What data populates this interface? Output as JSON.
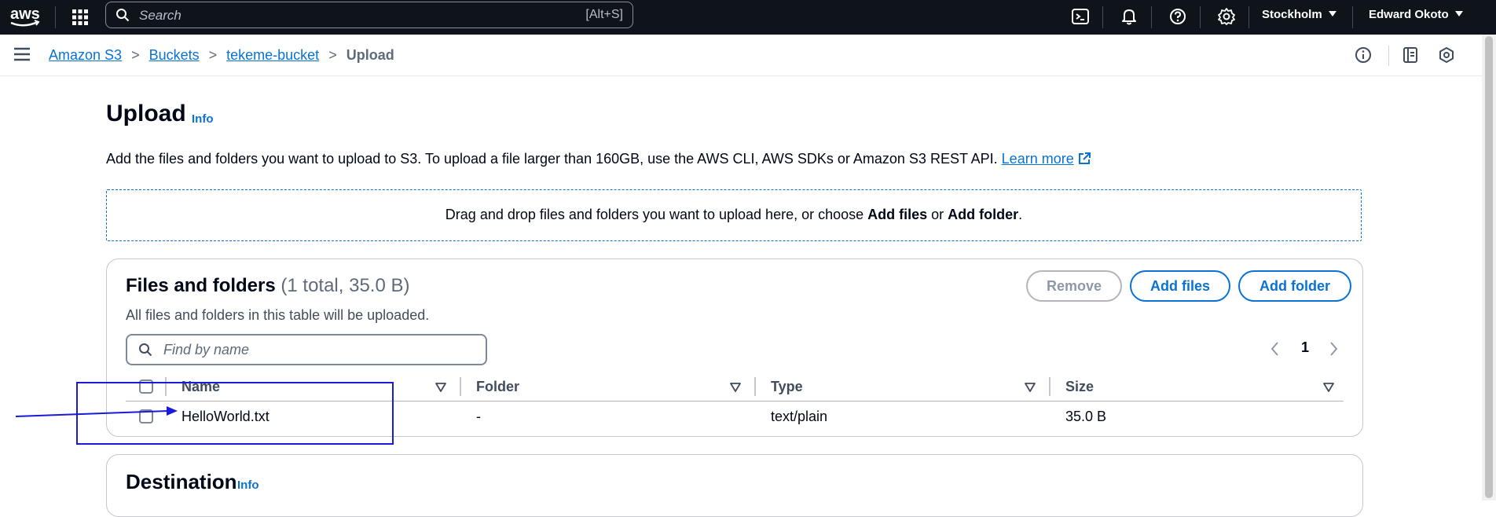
{
  "topnav": {
    "logo": "aws",
    "search_placeholder": "Search",
    "search_shortcut": "[Alt+S]",
    "region": "Stockholm",
    "user": "Edward Okoto",
    "icons": [
      "apps-grid-icon",
      "cloudshell-icon",
      "bell-icon",
      "help-icon",
      "gear-icon"
    ]
  },
  "breadcrumb": {
    "items": [
      "Amazon S3",
      "Buckets",
      "tekeme-bucket"
    ],
    "current": "Upload",
    "separator": ">"
  },
  "page": {
    "title": "Upload",
    "info": "Info",
    "description": "Add the files and folders you want to upload to S3. To upload a file larger than 160GB, use the AWS CLI, AWS SDKs or Amazon S3 REST API.",
    "learn_more": "Learn more",
    "dropzone_pre": "Drag and drop files and folders you want to upload here, or choose ",
    "dropzone_add_files": "Add files",
    "dropzone_or": " or ",
    "dropzone_add_folder": "Add folder",
    "dropzone_end": "."
  },
  "files_panel": {
    "title": "Files and folders",
    "count": "(1 total, 35.0 B)",
    "description": "All files and folders in this table will be uploaded.",
    "buttons": {
      "remove": "Remove",
      "add_files": "Add files",
      "add_folder": "Add folder"
    },
    "find_placeholder": "Find by name",
    "page": "1",
    "columns": [
      "Name",
      "Folder",
      "Type",
      "Size"
    ],
    "rows": [
      {
        "name": "HelloWorld.txt",
        "folder": "-",
        "type": "text/plain",
        "size": "35.0 B"
      }
    ]
  },
  "destination": {
    "title": "Destination",
    "info": "Info"
  },
  "colors": {
    "nav_bg": "#0f141a",
    "link": "#0972d3",
    "annotation": "#1a1adb"
  }
}
